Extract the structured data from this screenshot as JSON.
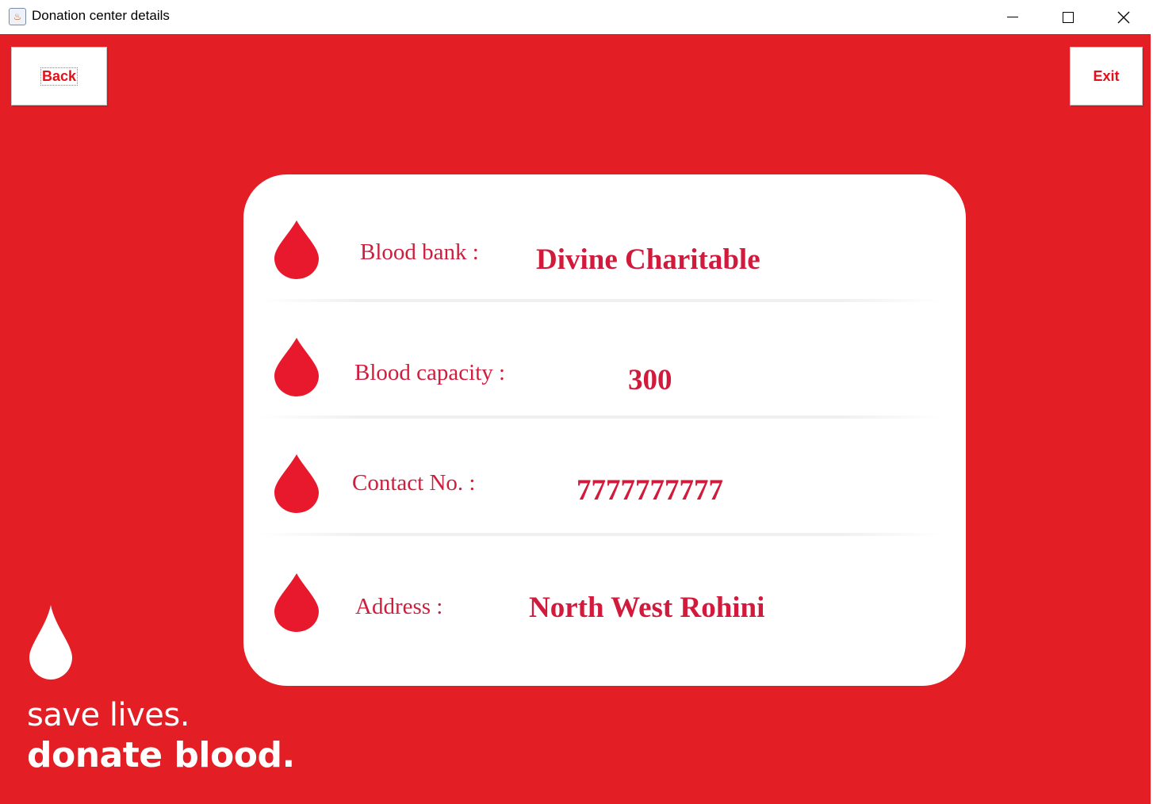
{
  "window": {
    "title": "Donation center details",
    "app_icon": "java-cup-icon"
  },
  "window_controls": {
    "minimize_icon": "minimize-icon",
    "maximize_icon": "maximize-icon",
    "close_icon": "close-icon",
    "close_glyph": "✕"
  },
  "toolbar": {
    "back_label": "Back",
    "exit_label": "Exit"
  },
  "details": [
    {
      "label": "Blood bank :",
      "value": "Divine Charitable",
      "icon": "blood-drop-icon"
    },
    {
      "label": "Blood capacity :",
      "value": "300",
      "icon": "blood-drop-icon"
    },
    {
      "label": "Contact No. :",
      "value": "7777777777",
      "icon": "blood-drop-icon"
    },
    {
      "label": "Address :",
      "value": "North West Rohini",
      "icon": "blood-drop-icon"
    }
  ],
  "slogan": {
    "line1": "save lives.",
    "line2": "donate blood.",
    "icon": "blood-drop-icon"
  },
  "colors": {
    "background": "#e31e24",
    "accent_text": "#d11a3c",
    "drop": "#e8192c",
    "card": "#ffffff"
  }
}
